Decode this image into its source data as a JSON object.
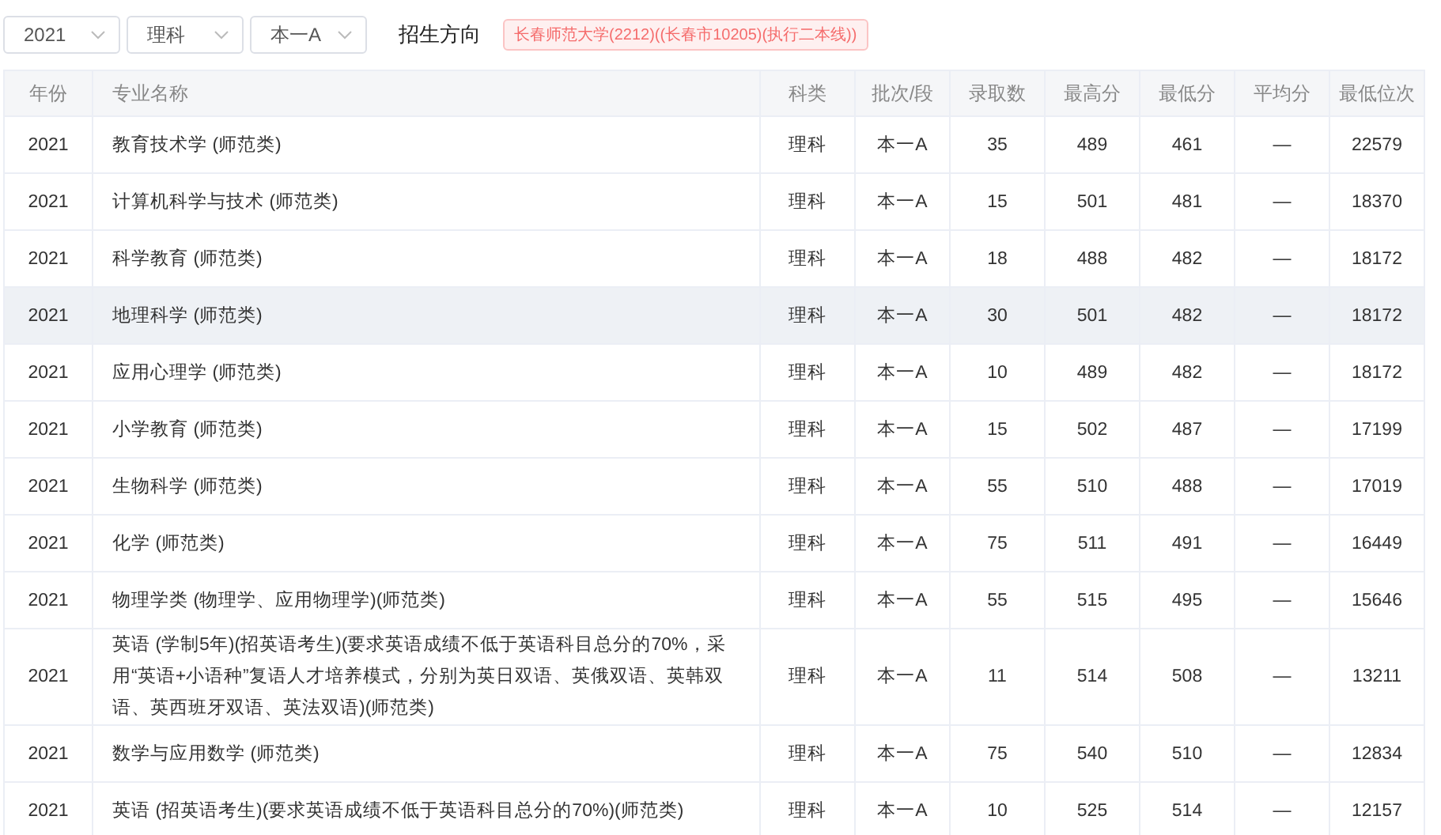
{
  "filters": [
    {
      "value": "2021"
    },
    {
      "value": "理科"
    },
    {
      "value": "本一A"
    }
  ],
  "direction": {
    "label": "招生方向",
    "tag": "长春师范大学(2212)((长春市10205)(执行二本线))"
  },
  "table": {
    "columns": [
      "年份",
      "专业名称",
      "科类",
      "批次/段",
      "录取数",
      "最高分",
      "最低分",
      "平均分",
      "最低位次"
    ],
    "rows": [
      {
        "cells": [
          "2021",
          "教育技术学 (师范类)",
          "理科",
          "本一A",
          "35",
          "489",
          "461",
          "—",
          "22579"
        ],
        "selected": false
      },
      {
        "cells": [
          "2021",
          "计算机科学与技术 (师范类)",
          "理科",
          "本一A",
          "15",
          "501",
          "481",
          "—",
          "18370"
        ],
        "selected": false
      },
      {
        "cells": [
          "2021",
          "科学教育 (师范类)",
          "理科",
          "本一A",
          "18",
          "488",
          "482",
          "—",
          "18172"
        ],
        "selected": false
      },
      {
        "cells": [
          "2021",
          "地理科学 (师范类)",
          "理科",
          "本一A",
          "30",
          "501",
          "482",
          "—",
          "18172"
        ],
        "selected": true
      },
      {
        "cells": [
          "2021",
          "应用心理学 (师范类)",
          "理科",
          "本一A",
          "10",
          "489",
          "482",
          "—",
          "18172"
        ],
        "selected": false
      },
      {
        "cells": [
          "2021",
          "小学教育 (师范类)",
          "理科",
          "本一A",
          "15",
          "502",
          "487",
          "—",
          "17199"
        ],
        "selected": false
      },
      {
        "cells": [
          "2021",
          "生物科学 (师范类)",
          "理科",
          "本一A",
          "55",
          "510",
          "488",
          "—",
          "17019"
        ],
        "selected": false
      },
      {
        "cells": [
          "2021",
          "化学 (师范类)",
          "理科",
          "本一A",
          "75",
          "511",
          "491",
          "—",
          "16449"
        ],
        "selected": false
      },
      {
        "cells": [
          "2021",
          "物理学类 (物理学、应用物理学)(师范类)",
          "理科",
          "本一A",
          "55",
          "515",
          "495",
          "—",
          "15646"
        ],
        "selected": false
      },
      {
        "cells": [
          "2021",
          "英语 (学制5年)(招英语考生)(要求英语成绩不低于英语科目总分的70%，采用“英语+小语种”复语人才培养模式，分别为英日双语、英俄双语、英韩双语、英西班牙双语、英法双语)(师范类)",
          "理科",
          "本一A",
          "11",
          "514",
          "508",
          "—",
          "13211"
        ],
        "selected": false
      },
      {
        "cells": [
          "2021",
          "数学与应用数学 (师范类)",
          "理科",
          "本一A",
          "75",
          "540",
          "510",
          "—",
          "12834"
        ],
        "selected": false
      },
      {
        "cells": [
          "2021",
          "英语 (招英语考生)(要求英语成绩不低于英语科目总分的70%)(师范类)",
          "理科",
          "本一A",
          "10",
          "525",
          "514",
          "—",
          "12157"
        ],
        "selected": false
      }
    ]
  }
}
